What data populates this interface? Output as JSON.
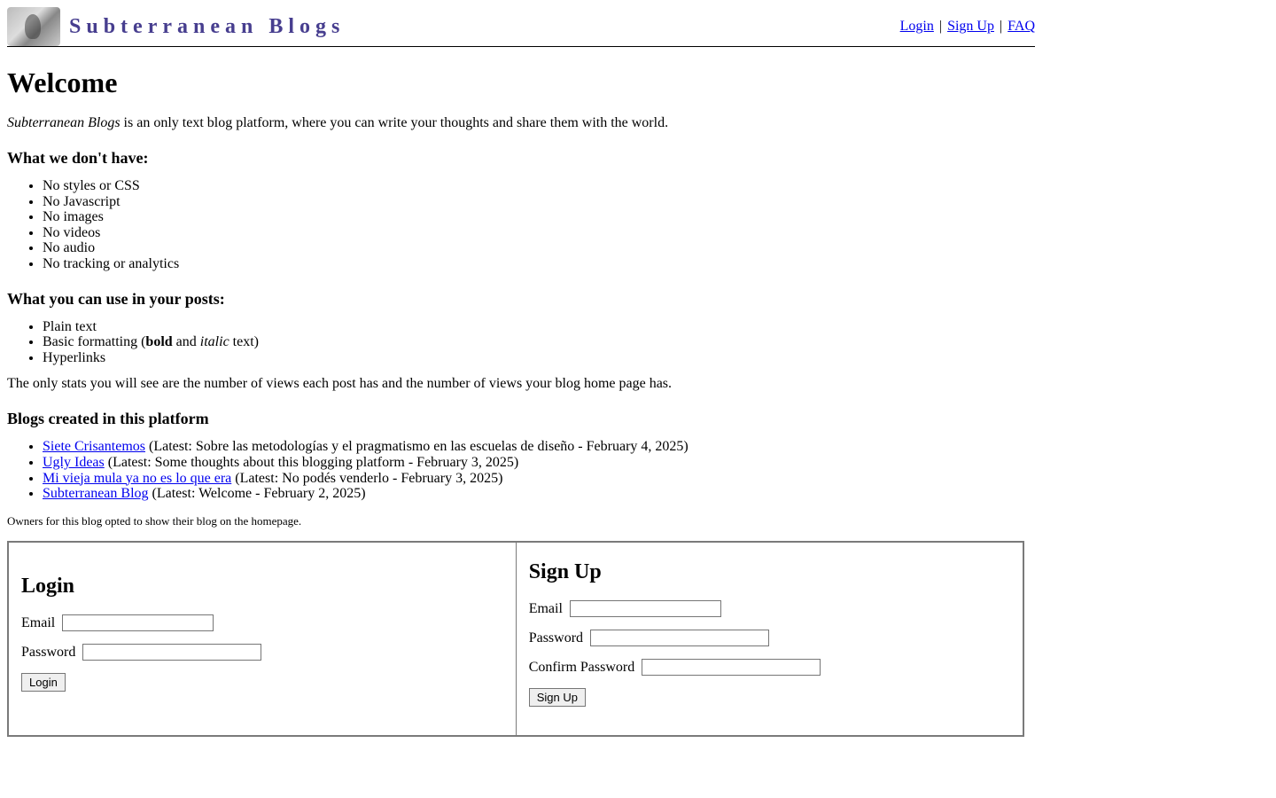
{
  "header": {
    "site_title": "Subterranean Blogs",
    "nav": {
      "login": "Login",
      "signup": "Sign Up",
      "faq": "FAQ"
    }
  },
  "main": {
    "welcome_heading": "Welcome",
    "intro_brand": "Subterranean Blogs",
    "intro_rest": " is an only text blog platform, where you can write your thoughts and share them with the world.",
    "dont_have_heading": "What we don't have:",
    "dont_have_items": [
      "No styles or CSS",
      "No Javascript",
      "No images",
      "No videos",
      "No audio",
      "No tracking or analytics"
    ],
    "can_use_heading": "What you can use in your posts:",
    "can_use": {
      "item0": "Plain text",
      "item1_prefix": "Basic formatting (",
      "item1_bold": "bold",
      "item1_mid": " and ",
      "item1_italic": "italic",
      "item1_suffix": " text)",
      "item2": "Hyperlinks"
    },
    "stats_para": "The only stats you will see are the number of views each post has and the number of views your blog home page has.",
    "blogs_heading": "Blogs created in this platform",
    "blogs": [
      {
        "name": "Siete Crisantemos",
        "latest": " (Latest: Sobre las metodologías y el pragmatismo en las escuelas de diseño - February 4, 2025)"
      },
      {
        "name": "Ugly Ideas",
        "latest": " (Latest: Some thoughts about this blogging platform - February 3, 2025)"
      },
      {
        "name": "Mi vieja mula ya no es lo que era",
        "latest": " (Latest: No podés venderlo - February 3, 2025)"
      },
      {
        "name": "Subterranean Blog",
        "latest": " (Latest: Welcome - February 2, 2025)"
      }
    ],
    "owners_note": "Owners for this blog opted to show their blog on the homepage."
  },
  "forms": {
    "login": {
      "title": "Login",
      "email_label": "Email",
      "password_label": "Password",
      "button": "Login"
    },
    "signup": {
      "title": "Sign Up",
      "email_label": "Email",
      "password_label": "Password",
      "confirm_label": "Confirm Password",
      "button": "Sign Up"
    }
  }
}
